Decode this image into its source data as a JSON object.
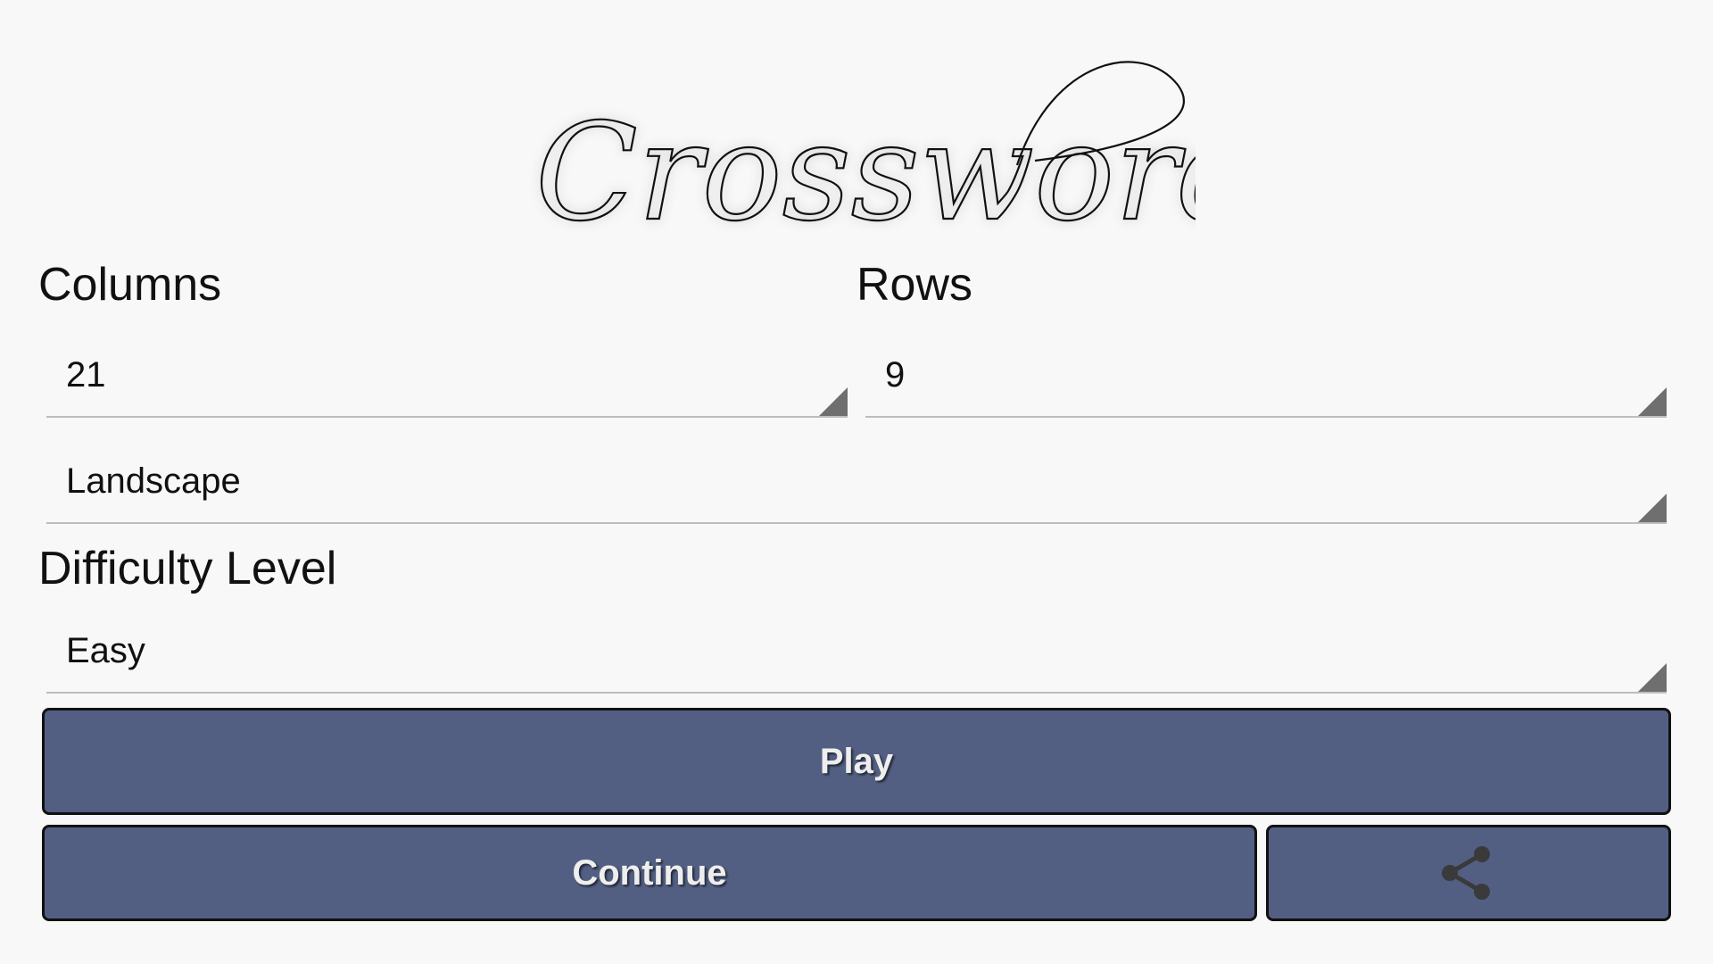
{
  "logo": {
    "text": "Crossword"
  },
  "columns": {
    "label": "Columns",
    "value": "21"
  },
  "rows": {
    "label": "Rows",
    "value": "9"
  },
  "orientation": {
    "value": "Landscape"
  },
  "difficulty": {
    "label": "Difficulty Level",
    "value": "Easy"
  },
  "buttons": {
    "play": "Play",
    "continue": "Continue",
    "share_icon": "share-icon"
  },
  "colors": {
    "background": "#f8f8f8",
    "button": "#525f82",
    "button_text": "#eeeeee",
    "underline": "#bdbdbd",
    "spinner_arrow": "#6f6f6f"
  }
}
